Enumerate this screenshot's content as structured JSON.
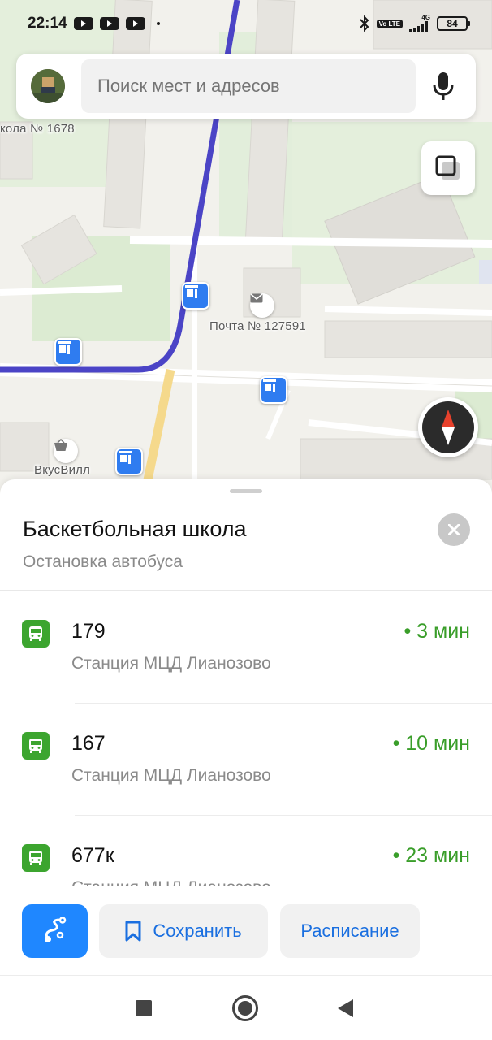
{
  "status_bar": {
    "time": "22:14",
    "notification_icons": [
      "youtube-icon",
      "youtube-icon",
      "youtube-icon"
    ],
    "network_label": "4G",
    "volte_label": "Vo LTE",
    "battery": "84"
  },
  "search": {
    "placeholder": "Поиск мест и адресов"
  },
  "map": {
    "labels": {
      "school": "кола № 1678",
      "post": "Почта № 127591",
      "shop": "ВкусВилл"
    },
    "colors": {
      "route": "#4b44c6",
      "road_yellow": "#f5d98c",
      "stop_pin": "#2f7cf0"
    }
  },
  "stop": {
    "title": "Баскетбольная школа",
    "subtitle": "Остановка автобуса"
  },
  "routes": [
    {
      "number": "179",
      "direction": "Станция МЦД Лианозово",
      "eta": "• 3 мин"
    },
    {
      "number": "167",
      "direction": "Станция МЦД Лианозово",
      "eta": "• 10 мин"
    },
    {
      "number": "677к",
      "direction": "Станция МЦД Лианозово",
      "eta": "• 23 мин"
    }
  ],
  "actions": {
    "save_label": "Сохранить",
    "schedule_label": "Расписание"
  },
  "accent_colors": {
    "primary_blue": "#1f87ff",
    "eta_green": "#3a9e2a",
    "bus_green": "#3ca52f"
  }
}
